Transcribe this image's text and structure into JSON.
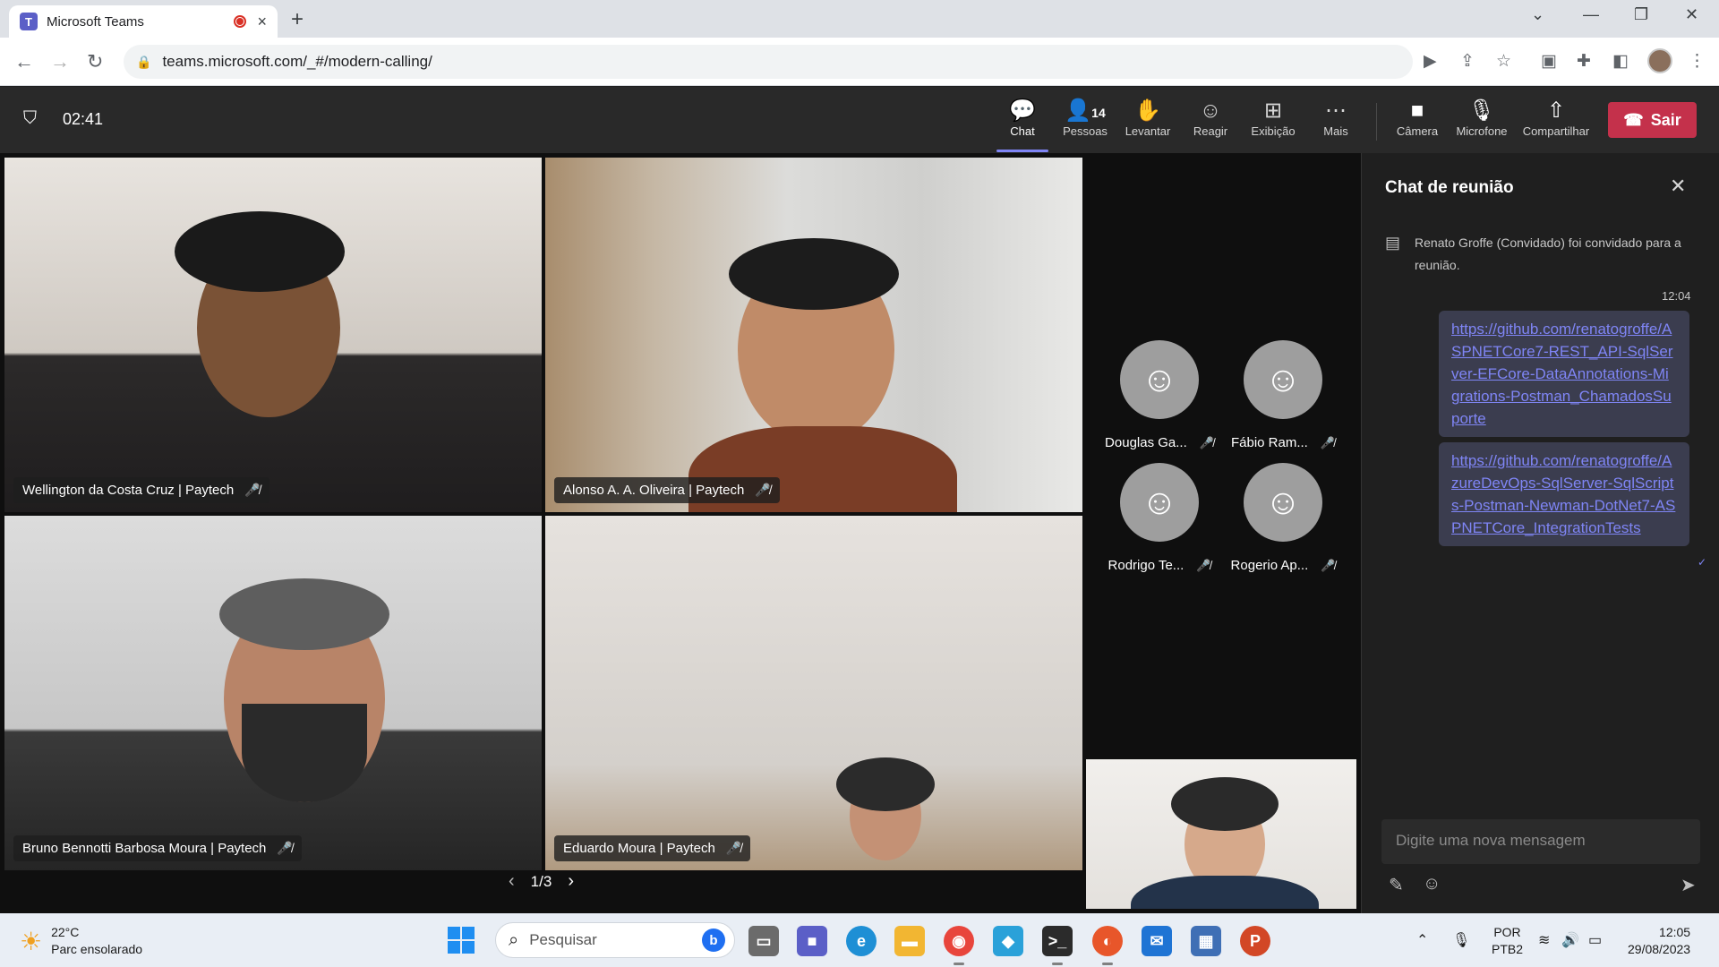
{
  "browser": {
    "tab_title": "Microsoft Teams",
    "tab_close": "×",
    "new_tab": "+",
    "url": "teams.microsoft.com/_#/modern-calling/"
  },
  "meeting": {
    "timer": "02:41",
    "toolbar": {
      "chat": "Chat",
      "people": "Pessoas",
      "people_count": "14",
      "raise": "Levantar",
      "react": "Reagir",
      "view": "Exibição",
      "more": "Mais",
      "camera": "Câmera",
      "mic": "Microfone",
      "share": "Compartilhar",
      "leave": "Sair"
    },
    "accent_color": "#7f85f5",
    "leave_color": "#c4314b",
    "participants_video": [
      {
        "name": "Wellington da Costa Cruz | Paytech"
      },
      {
        "name": "Alonso A. A. Oliveira | Paytech"
      },
      {
        "name": "Bruno Bennotti Barbosa Moura | Paytech"
      },
      {
        "name": "Eduardo Moura | Paytech"
      }
    ],
    "participants_avatar": [
      {
        "name": "Douglas Ga..."
      },
      {
        "name": "Fábio Ram..."
      },
      {
        "name": "Rodrigo Te..."
      },
      {
        "name": "Rogerio Ap..."
      }
    ],
    "pager": {
      "label": "1/3"
    }
  },
  "chat": {
    "title": "Chat de reunião",
    "system_message": "Renato Groffe (Convidado) foi convidado para a reunião.",
    "time": "12:04",
    "messages": [
      {
        "text": "https://github.com/renatogroffe/ASPNETCore7-REST_API-SqlServer-EFCore-DataAnnotations-Migrations-Postman_ChamadosSuporte"
      },
      {
        "text": "https://github.com/renatogroffe/AzureDevOps-SqlServer-SqlScripts-Postman-Newman-DotNet7-ASPNETCore_IntegrationTests"
      }
    ],
    "compose_placeholder": "Digite uma nova mensagem"
  },
  "taskbar": {
    "weather_temp": "22°C",
    "weather_desc": "Parc ensolarado",
    "search_placeholder": "Pesquisar",
    "lang_top": "POR",
    "lang_bottom": "PTB2",
    "time": "12:05",
    "date": "29/08/2023"
  }
}
